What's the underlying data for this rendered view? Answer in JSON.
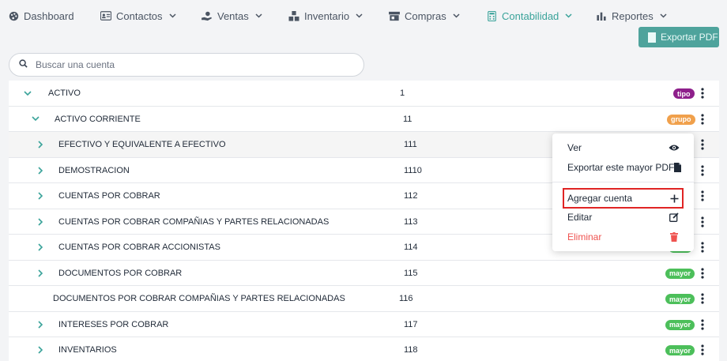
{
  "nav": {
    "items": [
      {
        "label": "Dashboard",
        "icon": "palette-icon"
      },
      {
        "label": "Contactos",
        "icon": "contact-card-icon"
      },
      {
        "label": "Ventas",
        "icon": "hand-dollar-icon"
      },
      {
        "label": "Inventario",
        "icon": "boxes-icon"
      },
      {
        "label": "Compras",
        "icon": "store-icon"
      },
      {
        "label": "Contabilidad",
        "icon": "calculator-icon"
      },
      {
        "label": "Reportes",
        "icon": "bar-chart-icon"
      }
    ],
    "active": "Contabilidad"
  },
  "toolbar": {
    "export_label": "Exportar PDF"
  },
  "search": {
    "placeholder": "Buscar una cuenta",
    "value": ""
  },
  "accounts": [
    {
      "name": "ACTIVO",
      "code": "1",
      "badge": "tipo",
      "expanded": true
    },
    {
      "name": "ACTIVO CORRIENTE",
      "code": "11",
      "badge": "grupo",
      "expanded": true
    },
    {
      "name": "EFECTIVO Y EQUIVALENTE A EFECTIVO",
      "code": "111",
      "badge": "",
      "expanded": false
    },
    {
      "name": "DEMOSTRACION",
      "code": "1110",
      "badge": "",
      "expanded": false
    },
    {
      "name": "CUENTAS POR COBRAR",
      "code": "112",
      "badge": "",
      "expanded": false
    },
    {
      "name": "CUENTAS POR COBRAR COMPAÑIAS Y PARTES RELACIONADAS",
      "code": "113",
      "badge": "",
      "expanded": false
    },
    {
      "name": "CUENTAS POR COBRAR ACCIONISTAS",
      "code": "114",
      "badge": "",
      "expanded": false
    },
    {
      "name": "DOCUMENTOS POR COBRAR",
      "code": "115",
      "badge": "mayor",
      "expanded": false
    },
    {
      "name": "DOCUMENTOS POR COBRAR COMPAÑIAS Y PARTES RELACIONADAS",
      "code": "116",
      "badge": "mayor",
      "expanded": false
    },
    {
      "name": "INTERESES POR COBRAR",
      "code": "117",
      "badge": "mayor",
      "expanded": false
    },
    {
      "name": "INVENTARIOS",
      "code": "118",
      "badge": "mayor",
      "expanded": false
    }
  ],
  "menu": {
    "items": [
      {
        "label": "Ver",
        "icon": "eye-icon"
      },
      {
        "label": "Exportar este mayor PDF",
        "icon": "file-icon"
      },
      {
        "label": "Agregar cuenta",
        "icon": "plus-icon"
      },
      {
        "label": "Editar",
        "icon": "edit-icon"
      },
      {
        "label": "Eliminar",
        "icon": "trash-icon"
      }
    ]
  },
  "colors": {
    "accent": "#3aa39a",
    "badge_tipo": "#8e1f8b",
    "badge_grupo": "#f0a04b",
    "badge_mayor": "#4cbf5a",
    "danger": "#ef5350",
    "highlight": "#e02424"
  }
}
